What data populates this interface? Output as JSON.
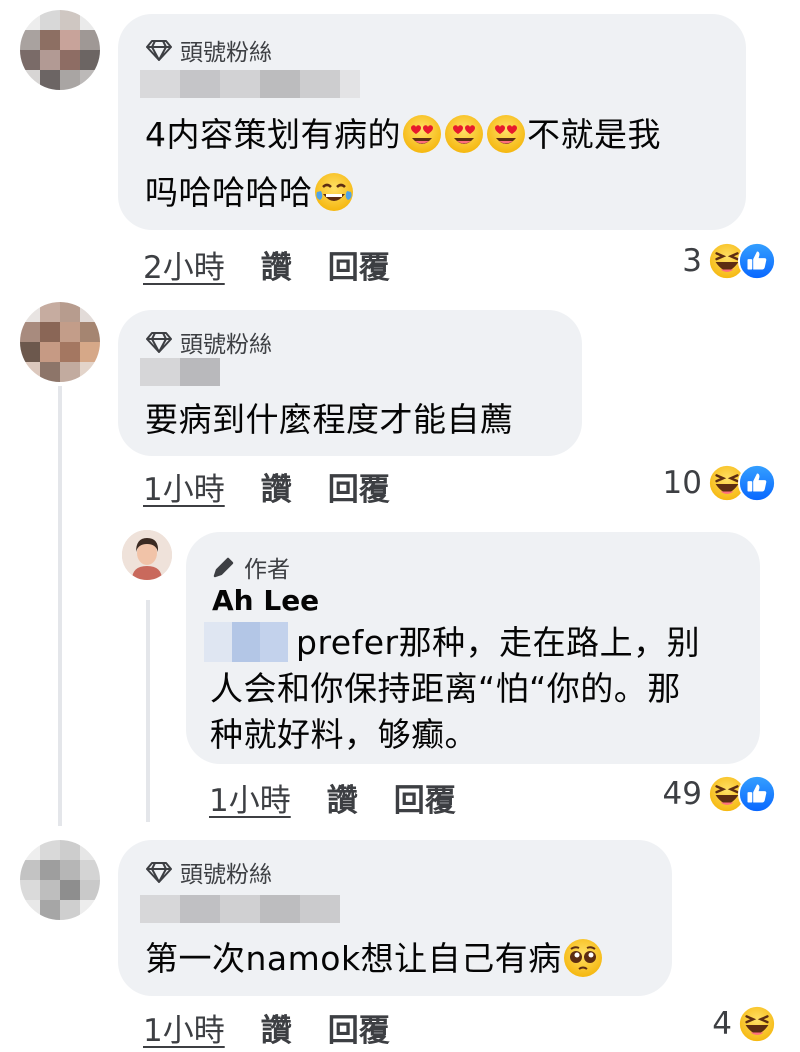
{
  "comments": [
    {
      "badge": "頭號粉絲",
      "text_before": "4内容策划有病的",
      "text_after": "不就是我",
      "line2": "吗哈哈哈哈",
      "time": "2小時",
      "like_label": "讚",
      "reply_label": "回覆",
      "reaction_count": "3"
    },
    {
      "badge": "頭號粉絲",
      "text": "要病到什麼程度才能自薦",
      "time": "1小時",
      "like_label": "讚",
      "reply_label": "回覆",
      "reaction_count": "10"
    },
    {
      "badge": "作者",
      "author": "Ah Lee",
      "line1": "prefer那种，走在路上，别",
      "line2": "人会和你保持距离“怕“你的。那",
      "line3": "种就好料，够癫。",
      "time": "1小時",
      "like_label": "讚",
      "reply_label": "回覆",
      "reaction_count": "49"
    },
    {
      "badge": "頭號粉絲",
      "text": "第一次namok想让自己有病",
      "time": "1小時",
      "like_label": "讚",
      "reply_label": "回覆",
      "reaction_count": "4"
    }
  ],
  "icons": {
    "badge": "diamond-icon",
    "author_badge": "pencil-icon",
    "reactions": [
      "haha-icon",
      "like-icon"
    ]
  },
  "colors": {
    "bubble": "#eff1f4",
    "like_blue": "#1877f2",
    "emoji_yellow": "#fbc02d"
  }
}
